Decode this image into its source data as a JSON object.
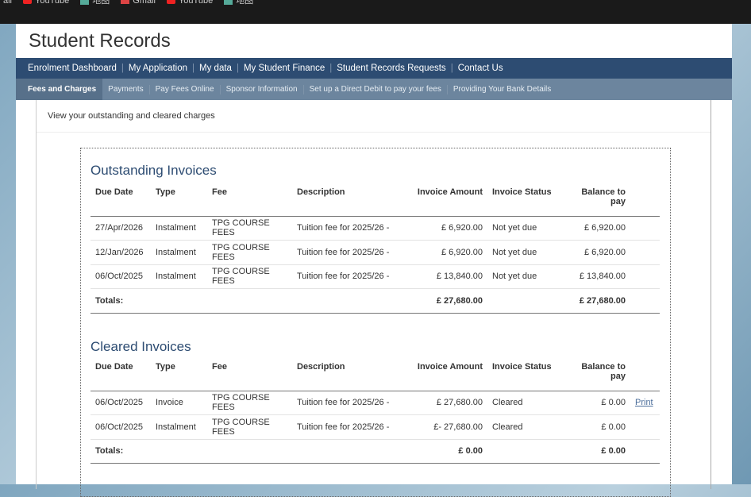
{
  "bookmarks": [
    "ail",
    "YouTube",
    "地图",
    "Gmail",
    "YouTube",
    "地图"
  ],
  "title": "Student Records",
  "nav": [
    "Enrolment Dashboard",
    "My Application",
    "My data",
    "My Student Finance",
    "Student Records Requests",
    "Contact Us"
  ],
  "subnav": [
    "Fees and Charges",
    "Payments",
    "Pay Fees Online",
    "Sponsor Information",
    "Set up a Direct Debit to pay your fees",
    "Providing Your Bank Details"
  ],
  "intro": "View your outstanding and cleared charges",
  "headers": [
    "Due Date",
    "Type",
    "Fee",
    "Description",
    "Invoice Amount",
    "Invoice Status",
    "Balance to pay"
  ],
  "outstanding": {
    "title": "Outstanding Invoices",
    "rows": [
      [
        "27/Apr/2026",
        "Instalment",
        "TPG COURSE FEES",
        "Tuition fee for 2025/26 -",
        "£ 6,920.00",
        "Not yet due",
        "£ 6,920.00",
        ""
      ],
      [
        "12/Jan/2026",
        "Instalment",
        "TPG COURSE FEES",
        "Tuition fee for 2025/26 -",
        "£ 6,920.00",
        "Not yet due",
        "£ 6,920.00",
        ""
      ],
      [
        "06/Oct/2025",
        "Instalment",
        "TPG COURSE FEES",
        "Tuition fee for 2025/26 -",
        "£ 13,840.00",
        "Not yet due",
        "£ 13,840.00",
        ""
      ]
    ],
    "totals_label": "Totals:",
    "total_amount": "£ 27,680.00",
    "total_balance": "£ 27,680.00"
  },
  "cleared": {
    "title": "Cleared Invoices",
    "rows": [
      [
        "06/Oct/2025",
        "Invoice",
        "TPG COURSE FEES",
        "Tuition fee for 2025/26 -",
        "£ 27,680.00",
        "Cleared",
        "£ 0.00",
        "Print"
      ],
      [
        "06/Oct/2025",
        "Instalment",
        "TPG COURSE FEES",
        "Tuition fee for 2025/26 -",
        "£- 27,680.00",
        "Cleared",
        "£ 0.00",
        ""
      ]
    ],
    "totals_label": "Totals:",
    "total_amount": "£ 0.00",
    "total_balance": "£ 0.00"
  }
}
